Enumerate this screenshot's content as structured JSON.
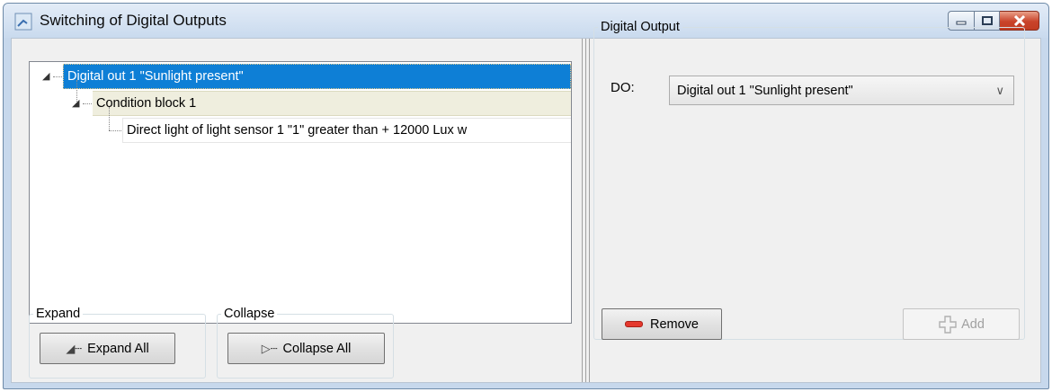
{
  "window": {
    "title": "Switching of Digital Outputs",
    "icon": "app-icon"
  },
  "tree": {
    "nodes": [
      {
        "label": "Digital out 1 \"Sunlight present\"",
        "expanded": true,
        "selected": true
      },
      {
        "label": "Condition block 1",
        "expanded": true
      },
      {
        "label": "Direct light of light sensor 1 \"1\" greater than + 12000 Lux w"
      }
    ]
  },
  "expand_group": {
    "legend": "Expand",
    "button_label": "Expand All"
  },
  "collapse_group": {
    "legend": "Collapse",
    "button_label": "Collapse All"
  },
  "digital_output": {
    "legend": "Digital Output",
    "do_label": "DO:",
    "selected_value": "Digital out 1 \"Sunlight present\"",
    "remove_label": "Remove",
    "add_label": "Add"
  },
  "colors": {
    "selection": "#0e7fd6",
    "condition_bg": "#efeede",
    "remove_icon": "#e5382d"
  }
}
